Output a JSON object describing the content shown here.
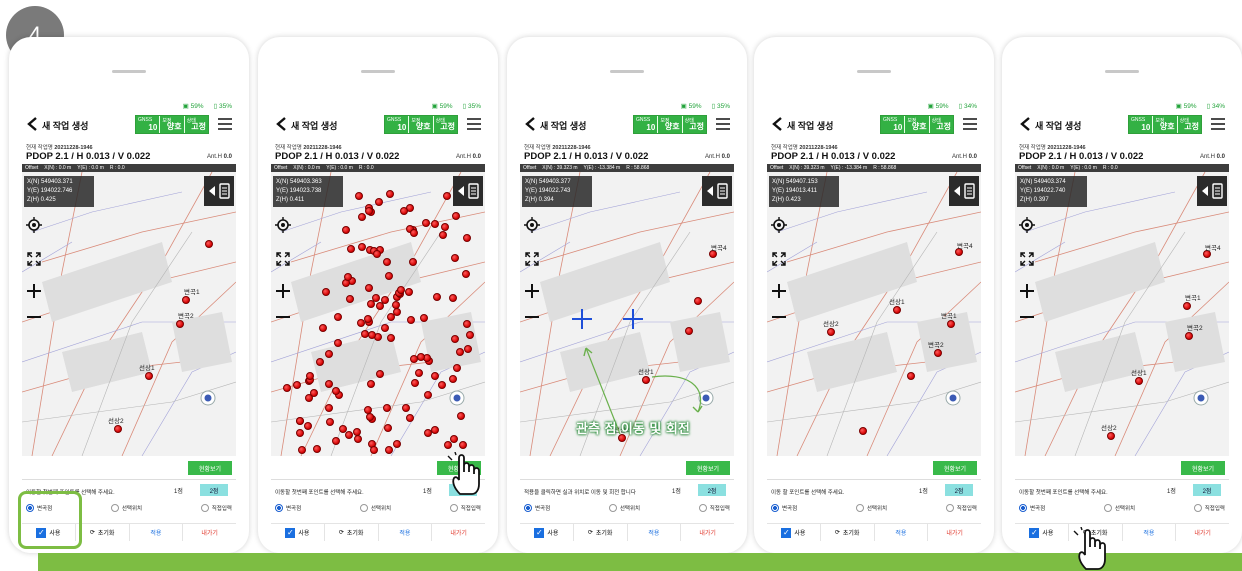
{
  "step_number": "4",
  "accent": "#7dbd43",
  "screens": [
    {
      "battery": "35%",
      "signal": "59%",
      "title": "새 작업 생성",
      "gnss": [
        "GNSS",
        "보정",
        "상태"
      ],
      "gnss_values": [
        "10",
        "양호",
        "고정"
      ],
      "job_label": "현재 작업명",
      "job_name": "20211228-1946",
      "pdop": "PDOP 2.1 / H 0.013 / V 0.022",
      "anth_label": "Ant.H",
      "anth_value": "0.0",
      "offset": [
        "Offset",
        "X(N) : 0.0 m",
        "Y(E) : 0.0 m",
        "R : 0.0"
      ],
      "coords": [
        "X(N) 549403.371",
        "Y(E) 194022.746",
        "Z(H) 0.425"
      ],
      "scale": "71.58 m",
      "view_button": "현황보기",
      "instruction": "이동할 첫번째 포인트를 선택해 주세요.",
      "tab1": "1점",
      "tab2": "2점",
      "radio": [
        "변곡점",
        "선택위치",
        "직접입력"
      ],
      "actions": [
        "사용",
        "초기화",
        "적용",
        "내가기"
      ]
    },
    {
      "battery": "35%",
      "signal": "59%",
      "title": "새 작업 생성",
      "gnss": [
        "GNSS",
        "보정",
        "상태"
      ],
      "gnss_values": [
        "10",
        "양호",
        "고정"
      ],
      "job_label": "현재 작업명",
      "job_name": "20211228-1946",
      "pdop": "PDOP 2.1 / H 0.013 / V 0.022",
      "anth_label": "Ant.H",
      "anth_value": "0.0",
      "offset": [
        "Offset",
        "X(N) : 0.0 m",
        "Y(E) : 0.0 m",
        "R : 0.0"
      ],
      "coords": [
        "X(N) 549403.363",
        "Y(E) 194023.738",
        "Z(H) 0.411"
      ],
      "scale": "71.58 m",
      "view_button": "현황보기",
      "instruction": "이동할 첫번째 포인트를 선택해 주세요.",
      "tab1": "1점",
      "tab2": "2점",
      "radio": [
        "변곡점",
        "선택위치",
        "직접입력"
      ],
      "actions": [
        "사용",
        "초기화",
        "적용",
        "내가기"
      ]
    },
    {
      "battery": "35%",
      "signal": "59%",
      "title": "새 작업 생성",
      "gnss": [
        "GNSS",
        "보정",
        "상태"
      ],
      "gnss_values": [
        "10",
        "양호",
        "고정"
      ],
      "job_label": "현재 작업명",
      "job_name": "20211228-1946",
      "pdop": "PDOP 2.1 / H 0.013 / V 0.022",
      "anth_label": "Ant.H",
      "anth_value": "0.0",
      "offset": [
        "Offset",
        "X(N) : 39.323 m",
        "Y(E) : -13.384 m",
        "R : 58.868"
      ],
      "coords": [
        "X(N) 549403.377",
        "Y(E) 194022.743",
        "Z(H) 0.394"
      ],
      "scale": "71.58 m",
      "view_button": "현황보기",
      "instruction": "적용을 클릭하면 실과 위치로 이동 및 회전 합니다",
      "tab1": "1점",
      "tab2": "2점",
      "radio": [
        "변곡점",
        "선택위치",
        "직접입력"
      ],
      "actions": [
        "사용",
        "초기화",
        "적용",
        "내가기"
      ]
    },
    {
      "battery": "34%",
      "signal": "59%",
      "title": "새 작업 생성",
      "gnss": [
        "GNSS",
        "보정",
        "상태"
      ],
      "gnss_values": [
        "10",
        "양호",
        "고정"
      ],
      "job_label": "현재 작업명",
      "job_name": "20211228-1946",
      "pdop": "PDOP 2.1 / H 0.013 / V 0.022",
      "anth_label": "Ant.H",
      "anth_value": "0.0",
      "offset": [
        "Offset",
        "X(N) : 39.323 m",
        "Y(E) : -13.384 m",
        "R : 58.868"
      ],
      "coords": [
        "X(N) 549407.153",
        "Y(E) 194013.411",
        "Z(H) 0.423"
      ],
      "scale": "71.58 m",
      "view_button": "현황보기",
      "instruction": "이동 할 포인트를 선택해 주세요.",
      "tab1": "1점",
      "tab2": "2점",
      "radio": [
        "변곡점",
        "선택위치",
        "직접입력"
      ],
      "actions": [
        "사용",
        "초기화",
        "적용",
        "내가기"
      ]
    },
    {
      "battery": "34%",
      "signal": "59%",
      "title": "새 작업 생성",
      "gnss": [
        "GNSS",
        "보정",
        "상태"
      ],
      "gnss_values": [
        "10",
        "양호",
        "고정"
      ],
      "job_label": "현재 작업명",
      "job_name": "20211228-1946",
      "pdop": "PDOP 2.1 / H 0.013 / V 0.022",
      "anth_label": "Ant.H",
      "anth_value": "0.0",
      "offset": [
        "Offset",
        "X(N) : 0.0 m",
        "Y(E) : 0.0 m",
        "R : 0.0"
      ],
      "coords": [
        "X(N) 549403.374",
        "Y(E) 194022.740",
        "Z(H) 0.397"
      ],
      "scale": "71.58 m",
      "view_button": "현황보기",
      "instruction": "이동할 첫번째 포인트를 선택해 주세요.",
      "tab1": "1점",
      "tab2": "2점",
      "radio": [
        "변곡점",
        "선택위치",
        "직접입력"
      ],
      "actions": [
        "사용",
        "초기화",
        "적용",
        "내가기"
      ]
    }
  ],
  "point_labels": {
    "s1": [
      "변곡1",
      "변곡2",
      "선상1",
      "선상2"
    ],
    "s3": [
      "변곡4",
      "선상1",
      "선상2"
    ],
    "s4": [
      "변곡4",
      "선상1",
      "선상2",
      "변곡1",
      "변곡2"
    ],
    "s5": [
      "변곡4",
      "변곡1",
      "변곡2",
      "선상1",
      "선상2"
    ]
  },
  "callout": "관측 점 이동 및 회전"
}
